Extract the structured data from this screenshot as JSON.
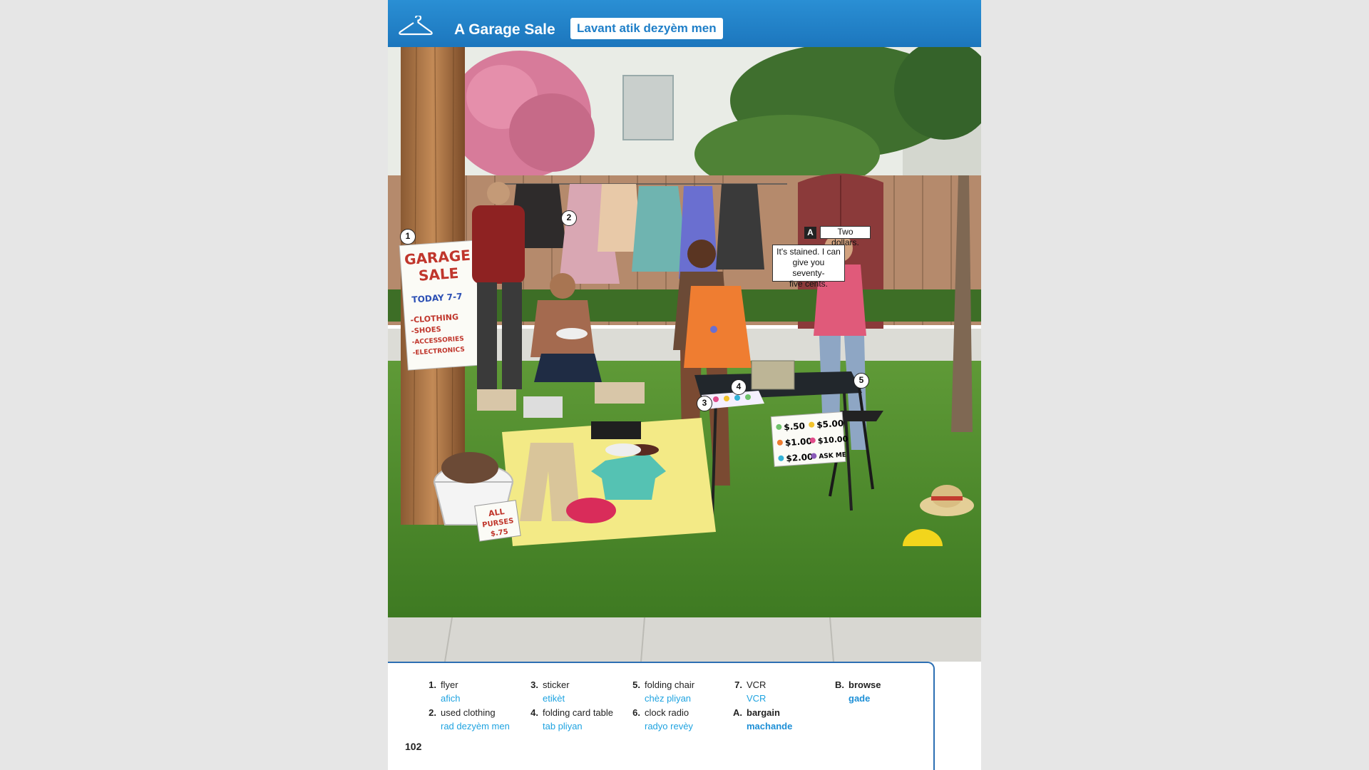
{
  "header": {
    "title": "A Garage Sale",
    "subtitle": "Lavant atik dezyèm men"
  },
  "illustration": {
    "callouts": [
      "1",
      "2",
      "3",
      "4",
      "5"
    ],
    "speech_a_label": "A",
    "speech_seller": "Two dollars.",
    "speech_buyer_line1": "It's stained. I can",
    "speech_buyer_line2": "give you seventy-",
    "speech_buyer_line3": "five cents.",
    "flyer": {
      "line1": "GARAGE",
      "line2": "SALE",
      "line3": "TODAY 7-7",
      "line4": "-CLOTHING",
      "line5": "-SHOES",
      "line6": "-ACCESSORIES",
      "line7": "-ELECTRONICS"
    },
    "price_sign": {
      "p1": "$.50",
      "p2": "$5.00",
      "p3": "$1.00",
      "p4": "$10.00",
      "p5": "$2.00",
      "p6": "ASK ME"
    },
    "purse_sign": {
      "line1": "ALL",
      "line2": "PURSES",
      "line3": "$.75"
    },
    "colors": {
      "sky_top": "#cfe0d8",
      "house": "#e9ece6",
      "fence": "#b58a6c",
      "grass": "#4b8a2a",
      "sidewalk": "#d8d7d2",
      "blanket": "#f3ea86"
    }
  },
  "vocabulary": {
    "items": [
      {
        "num": "1.",
        "en": "flyer",
        "ht": "afich"
      },
      {
        "num": "2.",
        "en": "used clothing",
        "ht": "rad dezyèm men"
      },
      {
        "num": "3.",
        "en": "sticker",
        "ht": "etikèt"
      },
      {
        "num": "4.",
        "en": "folding card table",
        "ht": "tab pliyan"
      },
      {
        "num": "5.",
        "en": "folding chair",
        "ht": "chèz pliyan"
      },
      {
        "num": "6.",
        "en": "clock radio",
        "ht": "radyo revèy"
      },
      {
        "num": "7.",
        "en": "VCR",
        "ht": "VCR"
      },
      {
        "num": "A.",
        "en": "bargain",
        "ht": "machande"
      },
      {
        "num": "B.",
        "en": "browse",
        "ht": "gade"
      }
    ],
    "page_number": "102"
  },
  "accent_color": "#1c7cc4"
}
